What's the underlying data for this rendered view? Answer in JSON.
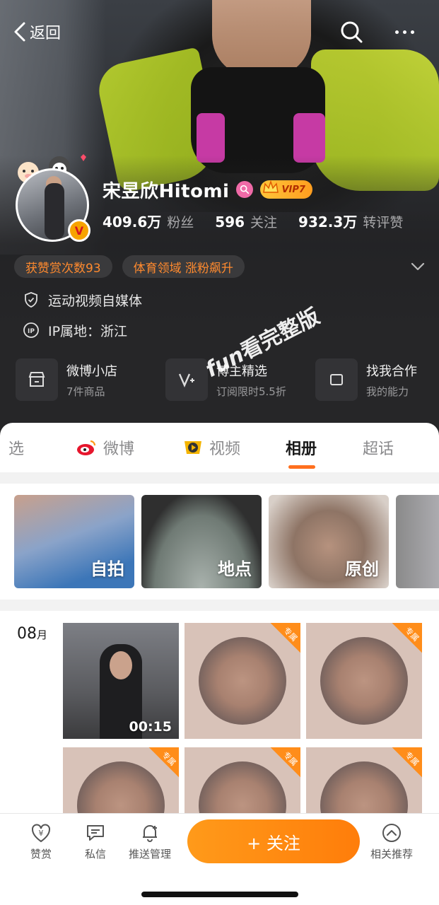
{
  "nav": {
    "back_label": "返回"
  },
  "profile": {
    "name": "宋昱欣Hitomi",
    "vip": "VIP7",
    "v_badge": "V",
    "stats": [
      {
        "num": "409.6万",
        "label": "粉丝"
      },
      {
        "num": "596",
        "label": "关注"
      },
      {
        "num": "932.3万",
        "label": "转评赞"
      }
    ],
    "tags": [
      "获赞赏次数93",
      "体育领域 涨粉飙升"
    ],
    "bio": "运动视频自媒体",
    "ip": "IP属地：浙江",
    "ip_icon_text": "IP"
  },
  "services": [
    {
      "title": "微博小店",
      "sub": "7件商品"
    },
    {
      "title": "博主精选",
      "sub": "订阅限时5.5折"
    },
    {
      "title": "找我合作",
      "sub": "我的能力"
    }
  ],
  "watermark": {
    "prefix": "fun",
    "text": "看完整版"
  },
  "tabs": [
    {
      "label": "选"
    },
    {
      "label": "微博"
    },
    {
      "label": "视频"
    },
    {
      "label": "相册"
    },
    {
      "label": "超话"
    }
  ],
  "album_categories": [
    {
      "label": "自拍"
    },
    {
      "label": "地点"
    },
    {
      "label": "原创"
    }
  ],
  "month": {
    "num": "08",
    "unit": "月"
  },
  "grid": {
    "exclusive_label": "专属",
    "video_duration": "00:15"
  },
  "bottom_bar": {
    "reward": "赞赏",
    "message": "私信",
    "push": "推送管理",
    "follow": "+ 关注",
    "related": "相关推荐"
  },
  "colors": {
    "accent_orange": "#ff7d0a",
    "tag_text": "#ff8a2e",
    "header_dark": "#262628"
  }
}
